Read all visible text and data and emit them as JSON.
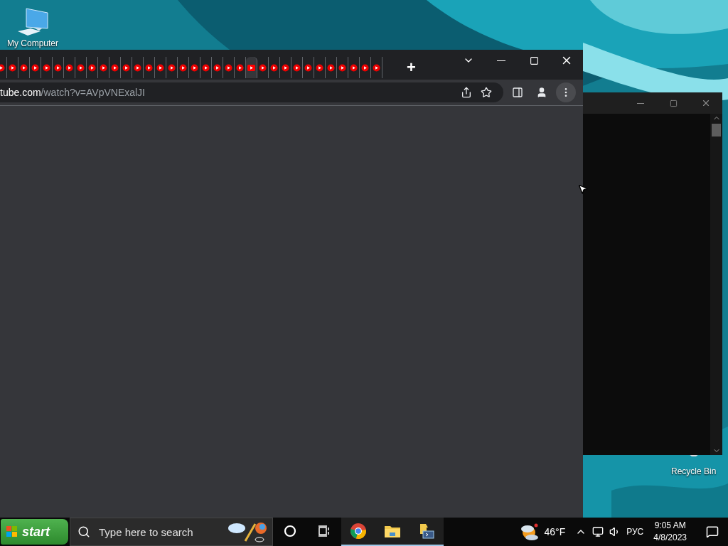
{
  "desktop": {
    "icons": [
      {
        "label": "My Computer",
        "kind": "computer"
      },
      {
        "label": "Recycle Bin",
        "kind": "recycle"
      }
    ]
  },
  "browser": {
    "tabs": [
      {
        "selected": false
      },
      {
        "selected": false
      },
      {
        "selected": false
      },
      {
        "selected": false
      },
      {
        "selected": false
      },
      {
        "selected": false
      },
      {
        "selected": false
      },
      {
        "selected": false
      },
      {
        "selected": false
      },
      {
        "selected": false
      },
      {
        "selected": false
      },
      {
        "selected": false
      },
      {
        "selected": false
      },
      {
        "selected": false
      },
      {
        "selected": false
      },
      {
        "selected": false
      },
      {
        "selected": false
      },
      {
        "selected": false
      },
      {
        "selected": false
      },
      {
        "selected": false
      },
      {
        "selected": false
      },
      {
        "selected": false
      },
      {
        "selected": true
      },
      {
        "selected": false
      },
      {
        "selected": false
      },
      {
        "selected": false
      },
      {
        "selected": false
      },
      {
        "selected": false
      },
      {
        "selected": false
      },
      {
        "selected": false
      },
      {
        "selected": false
      },
      {
        "selected": false
      },
      {
        "selected": false
      },
      {
        "selected": false
      }
    ],
    "new_tab": "+",
    "address": {
      "host": "tube.com",
      "path": "/watch?v=AVpVNExalJI"
    }
  },
  "taskbar": {
    "start": "start",
    "search": {
      "placeholder": "Type here to search"
    },
    "apps": [
      {
        "kind": "cortana",
        "running": false
      },
      {
        "kind": "task-view",
        "running": false
      },
      {
        "kind": "chrome",
        "running": true
      },
      {
        "kind": "explorer",
        "running": true
      },
      {
        "kind": "app",
        "running": true
      }
    ],
    "weather": "46°F",
    "language": "РУС",
    "time": "9:05 AM",
    "date": "4/8/2023"
  }
}
